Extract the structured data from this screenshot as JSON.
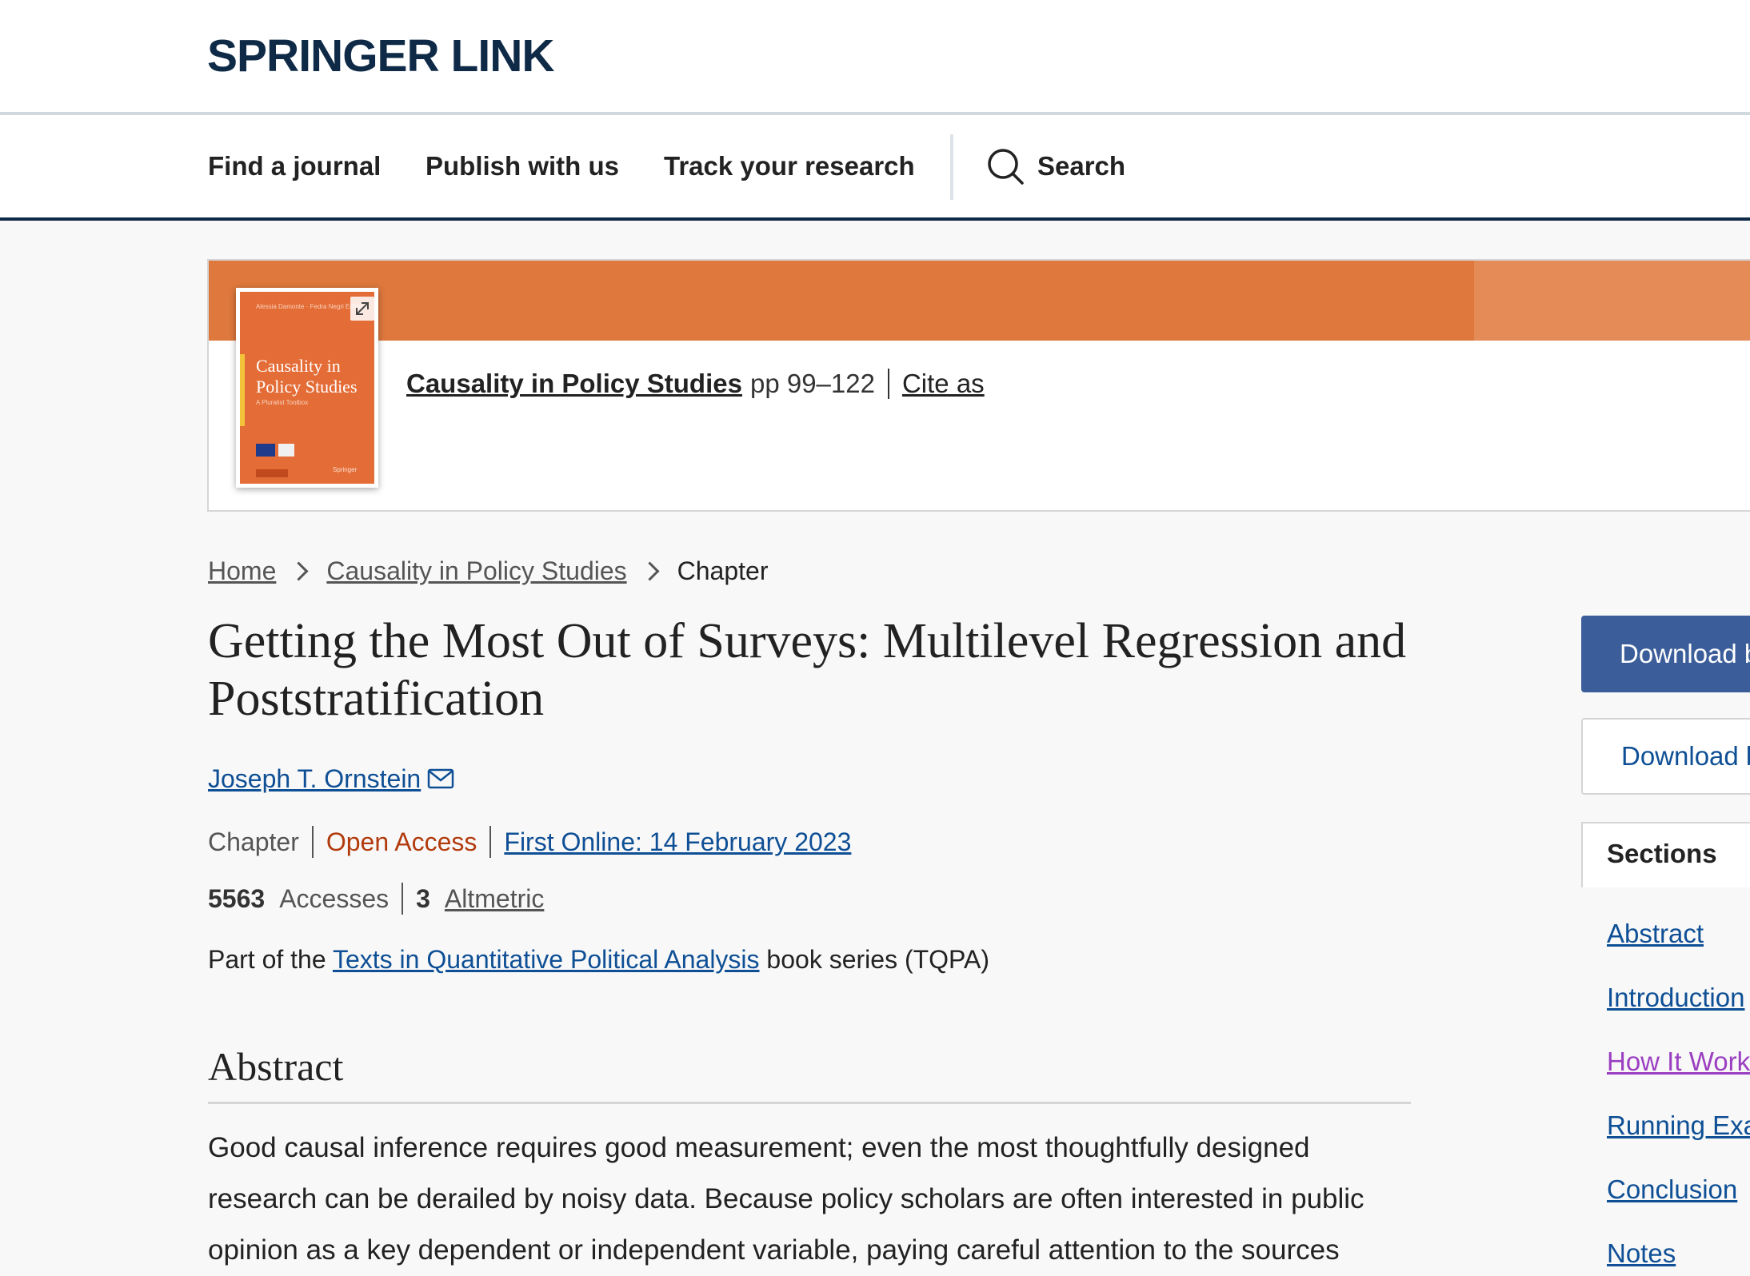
{
  "header": {
    "logo": "SPRINGER LINK"
  },
  "nav": {
    "items": [
      "Find a journal",
      "Publish with us",
      "Track your research"
    ],
    "search_label": "Search"
  },
  "banner": {
    "book_title": "Causality in Policy Studies",
    "pages": "pp 99–122",
    "cite_label": "Cite as",
    "cover": {
      "editors": "Alessia Damonte · Fedra Negri  Editors",
      "title": "Causality in Policy Studies",
      "subtitle": "A Pluralist Toolbox",
      "publisher": "Springer"
    }
  },
  "breadcrumb": {
    "home": "Home",
    "book": "Causality in Policy Studies",
    "current": "Chapter"
  },
  "chapter": {
    "title": "Getting the Most Out of Surveys: Multilevel Regression and Poststratification",
    "author": "Joseph T. Ornstein",
    "type": "Chapter",
    "access": "Open Access",
    "first_online": "First Online: 14 February 2023",
    "accesses_count": "5563",
    "accesses_label": "Accesses",
    "altmetric_count": "3",
    "altmetric_label": "Altmetric",
    "series_prefix": "Part of the ",
    "series_name": "Texts in Quantitative Political Analysis",
    "series_suffix": " book series (TQPA)"
  },
  "abstract": {
    "heading": "Abstract",
    "text": "Good causal inference requires good measurement; even the most thoughtfully designed research can be derailed by noisy data. Because policy scholars are often interested in public opinion as a key dependent or independent variable, paying careful attention to the sources"
  },
  "sidebar": {
    "download_primary": "Download book PDF",
    "download_secondary": "Download book EPUB",
    "sections_title": "Sections",
    "sections": [
      "Abstract",
      "Introduction",
      "How It Works",
      "Running Example",
      "Conclusion",
      "Notes"
    ]
  },
  "colors": {
    "brand_navy": "#0e2a47",
    "banner_orange": "#de783d",
    "link_blue": "#0e4f95",
    "open_access": "#b23b0d",
    "visited_link": "#9b3fc1",
    "download_button": "#3b5d9a"
  }
}
